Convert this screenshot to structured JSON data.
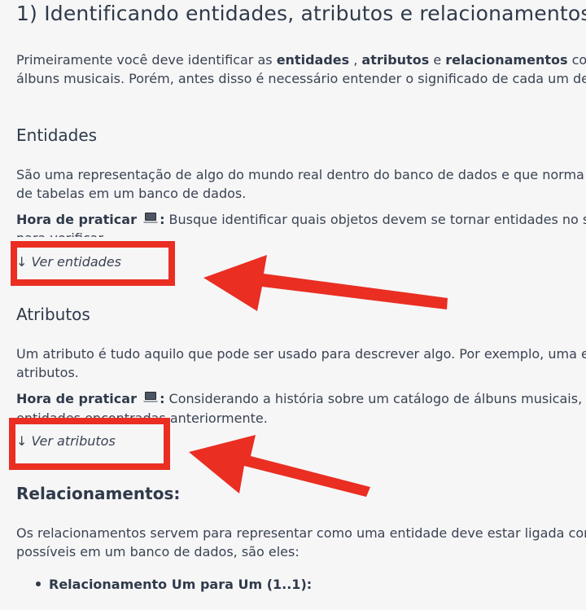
{
  "main": {
    "title": "1) Identificando entidades, atributos e relacionamentos",
    "intro": {
      "line1_prefix": "Primeiramente você deve identificar as ",
      "entidades": "entidades",
      "sep1": " , ",
      "atributos": "atributos",
      "sep2": " e ",
      "relacionamentos": "relacionamentos",
      "line1_suffix": " co",
      "line2": "álbuns musicais. Porém, antes disso é necessário entender o significado de cada um de"
    },
    "entidades_section": {
      "heading": "Entidades",
      "desc_line1": "São uma representação de algo do mundo real dentro do banco de dados e que norma",
      "desc_line2": "de tabelas em um banco de dados.",
      "practice_label": "Hora de praticar",
      "practice_colon": ":",
      "practice_text": " Busque identificar quais objetos devem se tornar entidades no s",
      "practice_overflow": "para verificar",
      "toggle": "↓ Ver entidades"
    },
    "atributos_section": {
      "heading": "Atributos",
      "desc_line1": "Um atributo é tudo aquilo que pode ser usado para descrever algo. Por exemplo, uma e",
      "desc_line2": "atributos.",
      "practice_label": "Hora de praticar",
      "practice_colon": ":",
      "practice_text": " Considerando a história sobre um catálogo de álbuns musicais, t",
      "practice_line2": "entidades encontradas anteriormente.",
      "toggle": "↓ Ver atributos"
    },
    "relacionamentos_section": {
      "heading": "Relacionamentos:",
      "desc_line1": "Os relacionamentos servem para representar como uma entidade deve estar ligada con",
      "desc_line2": "possíveis em um banco de dados, são eles:",
      "items": [
        "Relacionamento Um para Um (1..1):"
      ]
    }
  },
  "icons": {
    "practice_icon": "laptop-icon",
    "annotation_arrow": "red-arrow-icon"
  },
  "colors": {
    "background": "#f6f6f7",
    "text": "#3a4352",
    "heading": "#2f3a4a",
    "annotation": "#ea2e22"
  }
}
